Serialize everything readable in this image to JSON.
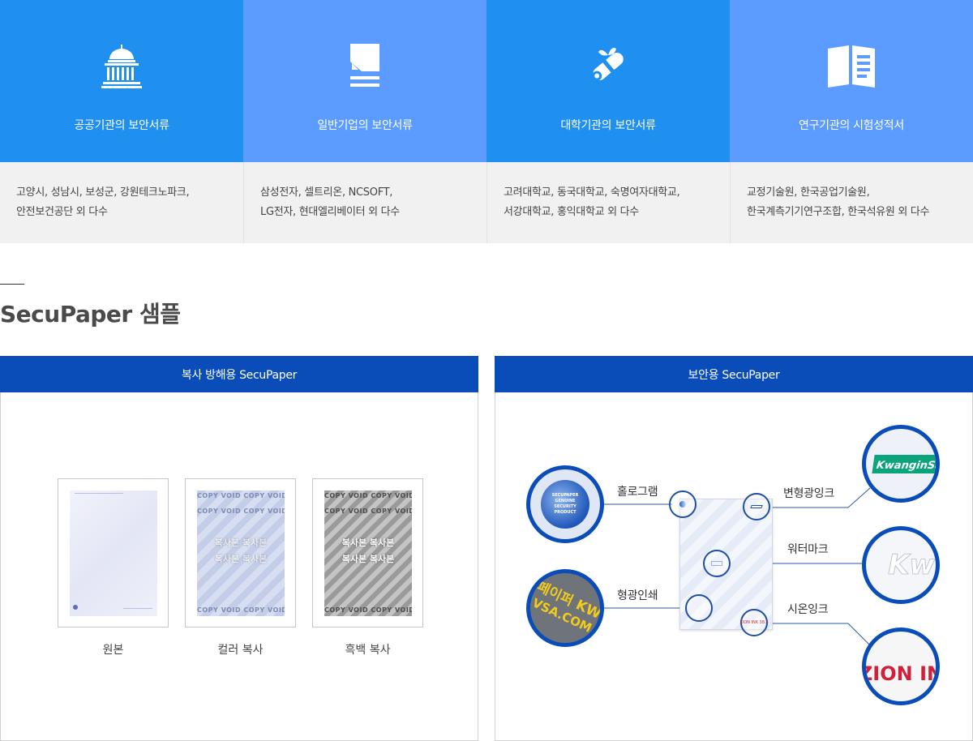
{
  "categories": [
    {
      "title": "공공기관의 보안서류",
      "icon": "capitol-building-icon",
      "clients_line1": "고양시, 성남시, 보성군, 강원테크노파크,",
      "clients_line2": "안전보건공단 외 다수"
    },
    {
      "title": "일반기업의 보안서류",
      "icon": "document-icon",
      "clients_line1": "삼성전자, 셀트리온, NCSOFT,",
      "clients_line2": "LG전자, 현대엘리베이터 외 다수"
    },
    {
      "title": "대학기관의 보안서류",
      "icon": "diploma-scroll-icon",
      "clients_line1": "고려대학교, 동국대학교, 숙명여자대학교,",
      "clients_line2": "서강대학교, 홍익대학교 외 다수"
    },
    {
      "title": "연구기관의 시험성적서",
      "icon": "open-book-icon",
      "clients_line1": "교정기술원, 한국공업기술원,",
      "clients_line2": "한국계측기기연구조합, 한국석유원 외 다수"
    }
  ],
  "section": {
    "title": "SecuPaper 샘플"
  },
  "copy_panel": {
    "title": "복사 방해용 SecuPaper",
    "samples": [
      {
        "label": "원본"
      },
      {
        "label": "컬러 복사"
      },
      {
        "label": "흑백 복사"
      }
    ],
    "copy_text": "COPY VOID  COPY VOID",
    "copy_large_text_1": "복사본 복사본",
    "copy_large_text_2": "복사본 복사본"
  },
  "secure_panel": {
    "title": "보안용 SecuPaper",
    "features": [
      {
        "label": "홀로그램",
        "lens_text": "SECUPAPER GENUINE SECURITY PRODUCT"
      },
      {
        "label": "형광인쇄",
        "lens_text": "페이퍼 KW",
        "lens_text_2": "VSA.COM"
      },
      {
        "label": "변형광잉크",
        "lens_text": "KwanginSa"
      },
      {
        "label": "워터마크",
        "lens_text": "Kw"
      },
      {
        "label": "시온잉크",
        "lens_text": "ZION IN"
      }
    ],
    "paper_ink_mark": "ZION INK 38.5"
  },
  "colors": {
    "card_blue_dark": "#1f8ff0",
    "card_blue_light": "#5c9bff",
    "panel_header": "#0b4db8",
    "lens_border": "#0b4db8",
    "zion_red": "#d21f3c",
    "kwanginsa_green": "#0aa37a"
  }
}
